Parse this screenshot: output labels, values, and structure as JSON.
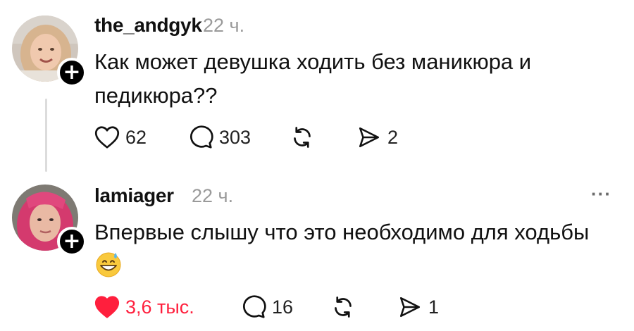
{
  "posts": [
    {
      "username": "the_andgyk",
      "time": "22 ч.",
      "text_line1": "Как может девушка ходить без маникюра и",
      "text_line2": "педикюра??",
      "likes": "62",
      "replies": "303",
      "shares": "2",
      "liked": false
    },
    {
      "username": "lamiager",
      "time": "22 ч.",
      "text_line1": "Впервые слышу что это необходимо для ходьбы",
      "emoji": "grinning-face-with-sweat",
      "likes": "3,6 тыс.",
      "replies": "16",
      "shares": "1",
      "liked": true,
      "more_label": "···"
    }
  ],
  "colors": {
    "like_active": "#ff1f3d",
    "muted_text": "#9a9a9a",
    "thread_line": "#dcdcdc"
  },
  "icons": [
    "heart-icon",
    "comment-icon",
    "repost-icon",
    "send-icon",
    "plus-icon"
  ]
}
